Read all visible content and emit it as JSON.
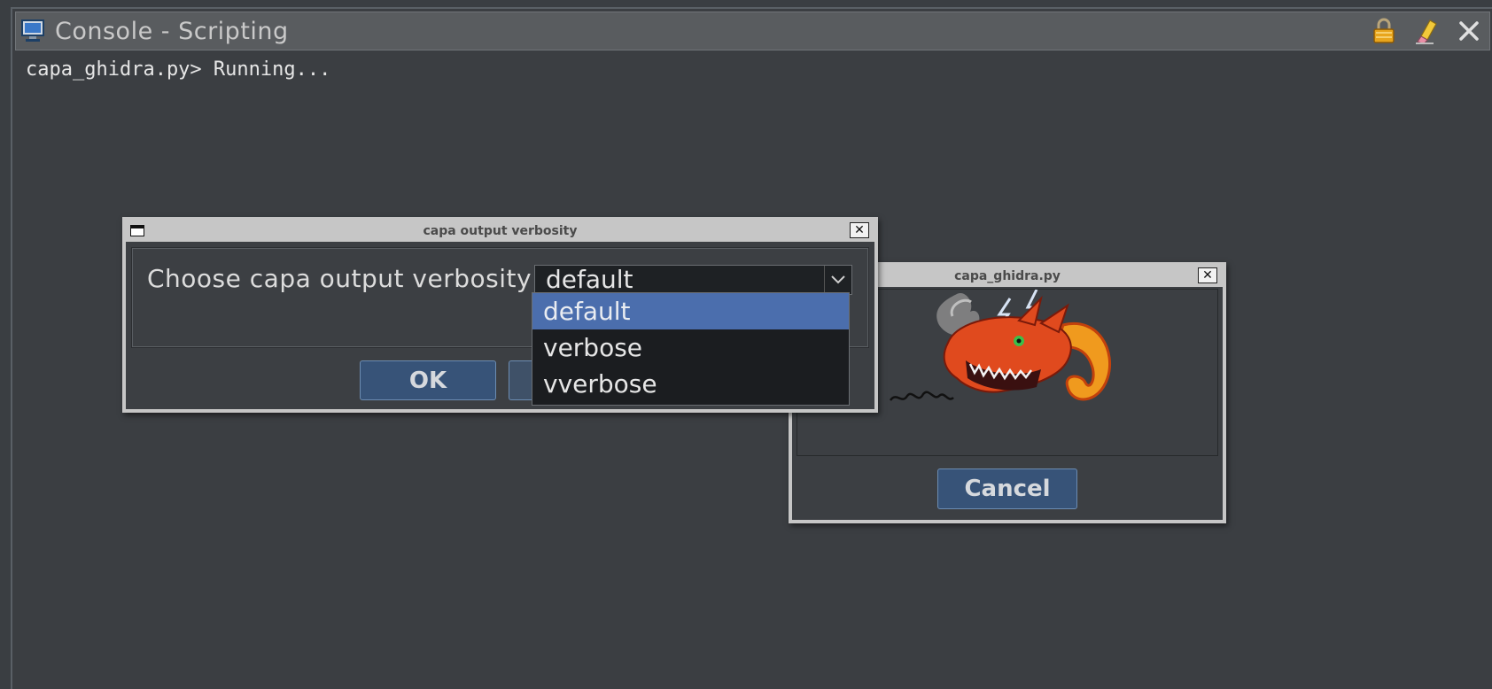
{
  "console": {
    "title": "Console - Scripting",
    "output": "capa_ghidra.py> Running...",
    "icons": [
      "monitor-icon",
      "lock-icon",
      "eraser-icon",
      "close-icon"
    ]
  },
  "verbosity_dialog": {
    "title": "capa output verbosity",
    "prompt": "Choose capa output verbosity",
    "selected": "default",
    "options": [
      "default",
      "verbose",
      "vverbose"
    ],
    "ok_label": "OK"
  },
  "progress_dialog": {
    "title": "capa_ghidra.py",
    "cancel_label": "Cancel"
  },
  "colors": {
    "background": "#3b3e42",
    "accent_button": "#375378",
    "selection": "#4b6ead"
  }
}
